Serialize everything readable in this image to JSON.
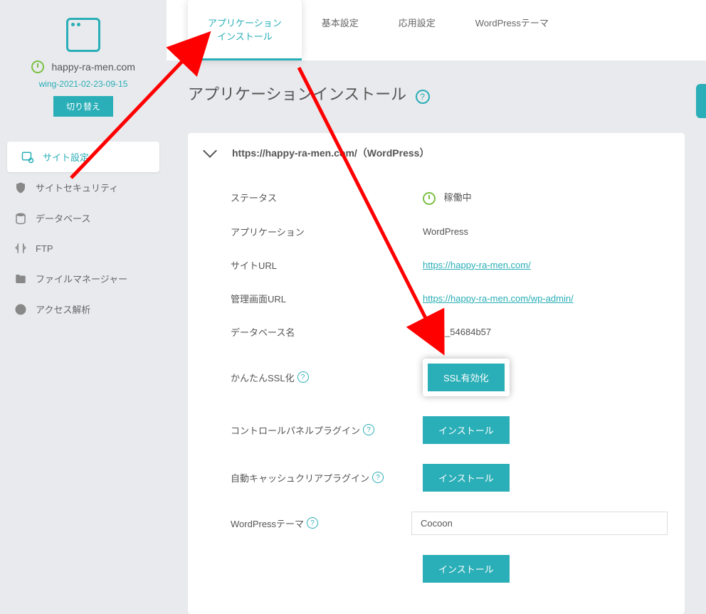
{
  "site": {
    "domain": "happy-ra-men.com",
    "server": "wing-2021-02-23-09-15",
    "switch_label": "切り替え"
  },
  "nav": {
    "items": [
      {
        "label": "サイト設定",
        "active": true,
        "icon": "globe-gear-icon"
      },
      {
        "label": "サイトセキュリティ",
        "active": false,
        "icon": "shield-icon"
      },
      {
        "label": "データベース",
        "active": false,
        "icon": "database-icon"
      },
      {
        "label": "FTP",
        "active": false,
        "icon": "ftp-icon"
      },
      {
        "label": "ファイルマネージャー",
        "active": false,
        "icon": "folder-icon"
      },
      {
        "label": "アクセス解析",
        "active": false,
        "icon": "piechart-icon"
      }
    ]
  },
  "tabs": [
    {
      "label_line1": "アプリケーション",
      "label_line2": "インストール",
      "active": true
    },
    {
      "label_line1": "基本設定",
      "label_line2": "",
      "active": false
    },
    {
      "label_line1": "応用設定",
      "label_line2": "",
      "active": false
    },
    {
      "label_line1": "WordPressテーマ",
      "label_line2": "",
      "active": false
    }
  ],
  "page": {
    "title": "アプリケーションインストール"
  },
  "accordion": {
    "title": "https://happy-ra-men.com/（WordPress）"
  },
  "details": {
    "status_label": "ステータス",
    "status_value": "稼働中",
    "app_label": "アプリケーション",
    "app_value": "WordPress",
    "siteurl_label": "サイトURL",
    "siteurl_value": "https://happy-ra-men.com/",
    "adminurl_label": "管理画面URL",
    "adminurl_value": "https://happy-ra-men.com/wp-admin/",
    "db_label": "データベース名",
    "db_value": "ztpce_54684b57",
    "ssl_label": "かんたんSSL化",
    "ssl_button": "SSL有効化",
    "cpplugin_label": "コントロールパネルプラグイン",
    "cpplugin_button": "インストール",
    "cache_label": "自動キャッシュクリアプラグイン",
    "cache_button": "インストール",
    "theme_label": "WordPressテーマ",
    "theme_value": "Cocoon",
    "theme_install_button": "インストール"
  }
}
